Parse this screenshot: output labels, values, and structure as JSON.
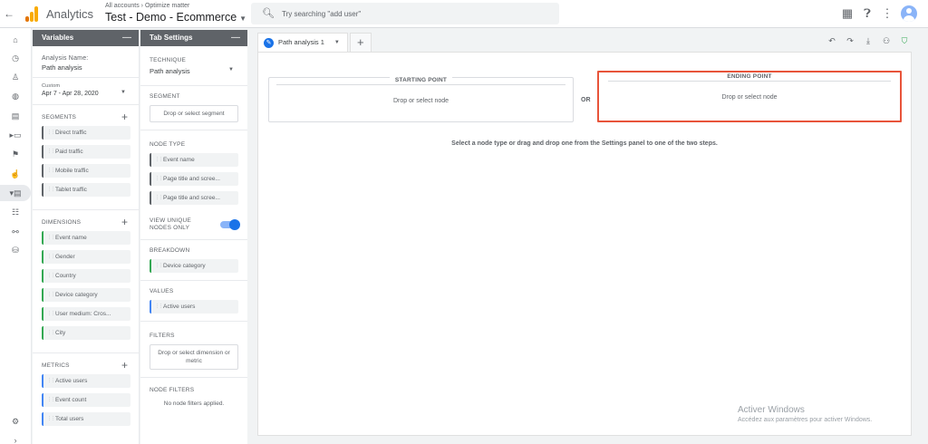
{
  "topbar": {
    "back_icon": "arrow-left-icon",
    "app_name": "Analytics",
    "breadcrumb": "All accounts › Optimize matter",
    "property": "Test - Demo - Ecommerce",
    "search_placeholder": "Try searching \"add user\"",
    "brand_colors": [
      "#f9ab00",
      "#e37400"
    ]
  },
  "rail": {
    "icons": [
      "home-icon",
      "clock-icon",
      "person-icon",
      "globe-icon",
      "table-icon",
      "devices-icon",
      "flag-icon",
      "hand-icon",
      "explore-icon",
      "audience-icon",
      "network-icon",
      "settings-icon"
    ]
  },
  "variables": {
    "header": "Variables",
    "analysis_name_label": "Analysis Name:",
    "analysis_name": "Path analysis",
    "date_label": "Custom",
    "date_range": "Apr 7 - Apr 28, 2020",
    "segments_label": "SEGMENTS",
    "segments": [
      "Direct traffic",
      "Paid traffic",
      "Mobile traffic",
      "Tablet traffic"
    ],
    "dimensions_label": "DIMENSIONS",
    "dimensions": [
      "Event name",
      "Gender",
      "Country",
      "Device category",
      "User medium: Cros...",
      "City"
    ],
    "metrics_label": "METRICS",
    "metrics": [
      "Active users",
      "Event count",
      "Total users"
    ]
  },
  "tab_settings": {
    "header": "Tab Settings",
    "technique_label": "TECHNIQUE",
    "technique": "Path analysis",
    "segment_label": "SEGMENT",
    "segment_drop": "Drop or select segment",
    "node_type_label": "NODE TYPE",
    "node_types": [
      "Event name",
      "Page title and scree...",
      "Page title and scree..."
    ],
    "unique_label": "VIEW UNIQUE NODES ONLY",
    "breakdown_label": "BREAKDOWN",
    "breakdown": "Device category",
    "values_label": "VALUES",
    "values": "Active users",
    "filters_label": "FILTERS",
    "filters_drop": "Drop or select dimension or metric",
    "node_filters_label": "NODE FILTERS",
    "node_filters_empty": "No node filters applied."
  },
  "canvas": {
    "tab_label": "Path analysis 1",
    "starting_point": "STARTING POINT",
    "ending_point": "ENDING POINT",
    "drop_node": "Drop or select node",
    "or": "OR",
    "hint": "Select a node type or drag and drop one from the Settings panel to one of the two steps.",
    "highlight_color": "#e8543a"
  },
  "watermark": {
    "line1": "Activer Windows",
    "line2": "Accédez aux paramètres pour activer Windows."
  }
}
